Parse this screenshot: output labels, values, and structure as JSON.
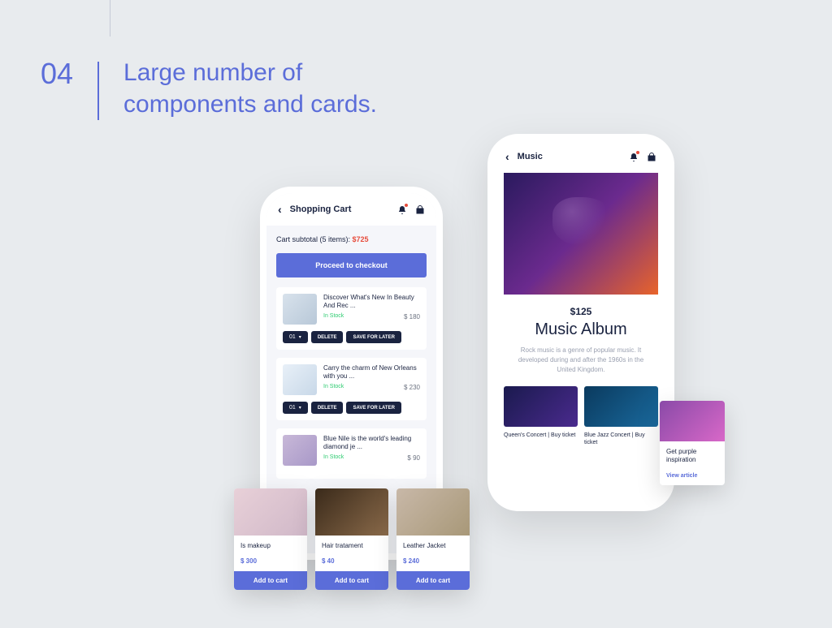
{
  "section": {
    "number": "04",
    "title_line1": "Large number of",
    "title_line2": "components and cards."
  },
  "cart_screen": {
    "header_title": "Shopping Cart",
    "subtotal_prefix": "Cart subtotal (5 items): ",
    "subtotal_price": "$725",
    "checkout_label": "Proceed to checkout",
    "qty_value": "01",
    "delete_label": "DELETE",
    "save_label": "SAVE FOR LATER",
    "in_stock_label": "In Stock",
    "items": [
      {
        "title": "Discover What's New In Beauty And Rec ...",
        "price": "$ 180"
      },
      {
        "title": "Carry the charm of New Orleans with you ...",
        "price": "$ 230"
      },
      {
        "title": "Blue Nile is the world's leading diamond je ...",
        "price": "$ 90"
      }
    ]
  },
  "music_screen": {
    "header_title": "Music",
    "album_price": "$125",
    "album_title": "Music Album",
    "album_desc": "Rock music is a genre of popular music. It developed during and after the 1960s in the United Kingdom.",
    "concerts": [
      {
        "label": "Queen's Concert | Buy ticket"
      },
      {
        "label": "Blue Jazz Concert | Buy ticket"
      }
    ]
  },
  "article_card": {
    "title": "Get purple inspiration",
    "link_label": "View article"
  },
  "product_cards": [
    {
      "title": "Is makeup",
      "price": "$ 300"
    },
    {
      "title": "Hair tratament",
      "price": "$ 40"
    },
    {
      "title": "Leather Jacket",
      "price": "$ 240"
    }
  ],
  "add_to_cart_label": "Add to cart"
}
